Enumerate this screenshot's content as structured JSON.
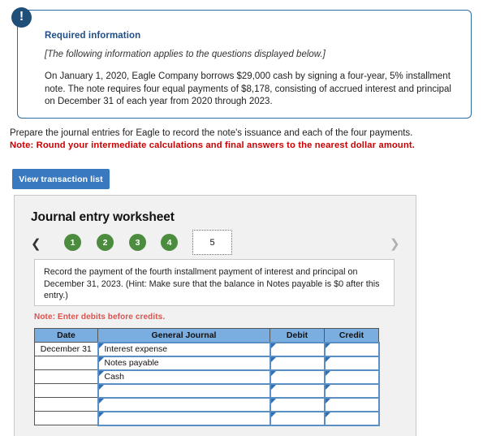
{
  "callout": {
    "icon": "exclamation-icon",
    "title": "Required information",
    "subtitle": "[The following information applies to the questions displayed below.]",
    "body": "On January 1, 2020, Eagle Company borrows $29,000 cash by signing a four-year, 5% installment note. The note requires four equal payments of $8,178, consisting of accrued interest and principal on December 31 of each year from 2020 through 2023.",
    "border_color": "#2e6da4",
    "title_color": "#1f4e87"
  },
  "prompt": {
    "line1": "Prepare the journal entries for Eagle to record the note's issuance and each of the four payments.",
    "note": "Note: Round your intermediate calculations and final answers to the nearest dollar amount.",
    "note_color": "#cc0000"
  },
  "toolbar": {
    "view_transaction_list_label": "View transaction list",
    "button_color": "#3879c0"
  },
  "worksheet": {
    "title": "Journal entry worksheet",
    "panel_bg": "#f1f1f1",
    "pager": {
      "prev_icon": "chevron-left-icon",
      "next_icon": "chevron-right-icon",
      "steps": [
        {
          "label": "1",
          "state": "completed"
        },
        {
          "label": "2",
          "state": "completed"
        },
        {
          "label": "3",
          "state": "completed"
        },
        {
          "label": "4",
          "state": "completed"
        },
        {
          "label": "5",
          "state": "current"
        }
      ],
      "completed_color": "#4c8c3f",
      "current_bg": "#ffffff"
    },
    "instruction": "Record the payment of the fourth installment payment of interest and principal on December 31, 2023. (Hint: Make sure that the balance in Notes payable is $0 after this entry.)",
    "debit_note": "Note: Enter debits before credits.",
    "debit_note_color": "#d9534f",
    "table": {
      "header_bg": "#7baee0",
      "columns": [
        "Date",
        "General Journal",
        "Debit",
        "Credit"
      ],
      "rows": [
        {
          "date": "December 31",
          "account": "Interest expense",
          "debit": "",
          "credit": ""
        },
        {
          "date": "",
          "account": "Notes payable",
          "debit": "",
          "credit": ""
        },
        {
          "date": "",
          "account": "Cash",
          "debit": "",
          "credit": ""
        },
        {
          "date": "",
          "account": "",
          "debit": "",
          "credit": ""
        },
        {
          "date": "",
          "account": "",
          "debit": "",
          "credit": ""
        },
        {
          "date": "",
          "account": "",
          "debit": "",
          "credit": ""
        }
      ]
    }
  }
}
